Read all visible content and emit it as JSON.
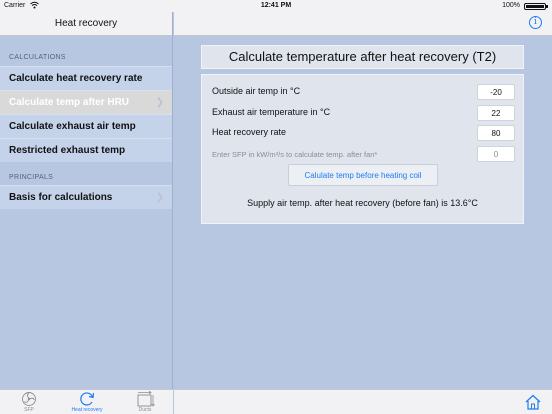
{
  "status_bar": {
    "carrier": "Carrier",
    "time": "12:41 PM",
    "battery": "100%"
  },
  "master": {
    "title": "Heat recovery",
    "sections": [
      {
        "header": "CALCULATIONS",
        "items": [
          {
            "label": "Calculate heat recovery rate",
            "selected": false
          },
          {
            "label": "Calculate temp after HRU",
            "selected": true
          },
          {
            "label": "Calculate exhaust air temp",
            "selected": false
          },
          {
            "label": "Restricted exhaust temp",
            "selected": false
          }
        ]
      },
      {
        "header": "PRINCIPALS",
        "items": [
          {
            "label": "Basis for calculations",
            "selected": false
          }
        ]
      }
    ]
  },
  "tabbar": {
    "tabs": [
      {
        "label": "SFP",
        "icon": "fan-icon",
        "active": false
      },
      {
        "label": "Heat recovery",
        "icon": "refresh-icon",
        "active": true
      },
      {
        "label": "Ducts",
        "icon": "duct-icon",
        "active": false
      }
    ]
  },
  "detail": {
    "title": "Calculate temperature after heat recovery (T2)",
    "fields": [
      {
        "label": "Outside air temp in °C",
        "value": "-20"
      },
      {
        "label": "Exhaust air temperature in °C",
        "value": "22"
      },
      {
        "label": "Heat recovery rate",
        "value": "80"
      },
      {
        "label": "Enter SFP  in kW/m³/s to calculate temp. after fan*",
        "value": "0"
      }
    ],
    "button_label": "Calulate temp before heating coil",
    "result": "Supply air temp. after heat recovery (before fan) is 13.6°C"
  },
  "colors": {
    "accent": "#1e7cf2",
    "background": "#b7c7e2",
    "panel": "#dfe4ed"
  }
}
